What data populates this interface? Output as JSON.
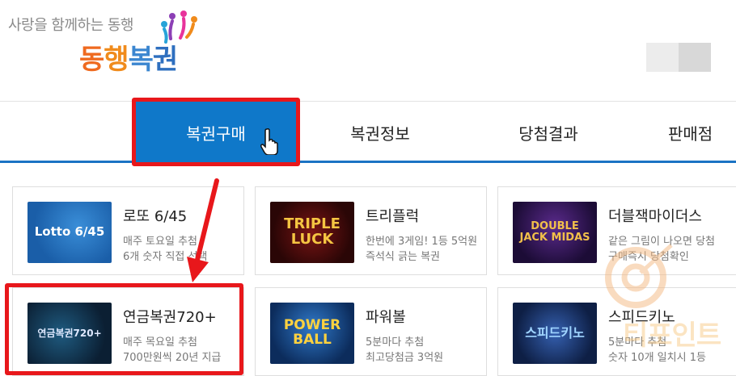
{
  "header": {
    "tagline": "사랑을 함께하는 동행",
    "logo_parts": [
      "동",
      "행",
      "복",
      "권"
    ],
    "logo_icon": "people-celebration-icon"
  },
  "nav": {
    "items": [
      {
        "label": "복권구매",
        "active": true
      },
      {
        "label": "복권정보"
      },
      {
        "label": "당첨결과"
      },
      {
        "label": "판매점"
      }
    ],
    "cursor_icon": "hand-pointer-icon",
    "accent_color": "#0f78c9",
    "highlight_color": "#e8171b"
  },
  "products": [
    {
      "name": "로또 6/45",
      "desc1": "매주 토요일 추첨",
      "desc2": "6개 숫자 직접 선택",
      "thumb_label": "Lotto 6/45"
    },
    {
      "name": "트리플럭",
      "desc1": "한번에 3게임! 1등 5억원",
      "desc2": "즉석식 긁는 복권",
      "thumb_label": "TRIPLE LUCK"
    },
    {
      "name": "더블잭마이더스",
      "desc1": "같은 그림이 나오면 당첨",
      "desc2": "구매즉시 당첨확인",
      "thumb_label": "DOUBLE JACK MIDAS"
    },
    {
      "name": "연금복권720+",
      "desc1": "매주 목요일 추첨",
      "desc2": "700만원씩 20년 지급",
      "thumb_label": "연금복권720+"
    },
    {
      "name": "파워볼",
      "desc1": "5분마다 추첨",
      "desc2": "최고당첨금 3억원",
      "thumb_label": "POWER BALL"
    },
    {
      "name": "스피드키노",
      "desc1": "5분마다 추첨",
      "desc2": "숫자 10개 일치시 1등",
      "thumb_label": "스피드키노"
    }
  ],
  "watermark": {
    "text": "티포인트"
  }
}
